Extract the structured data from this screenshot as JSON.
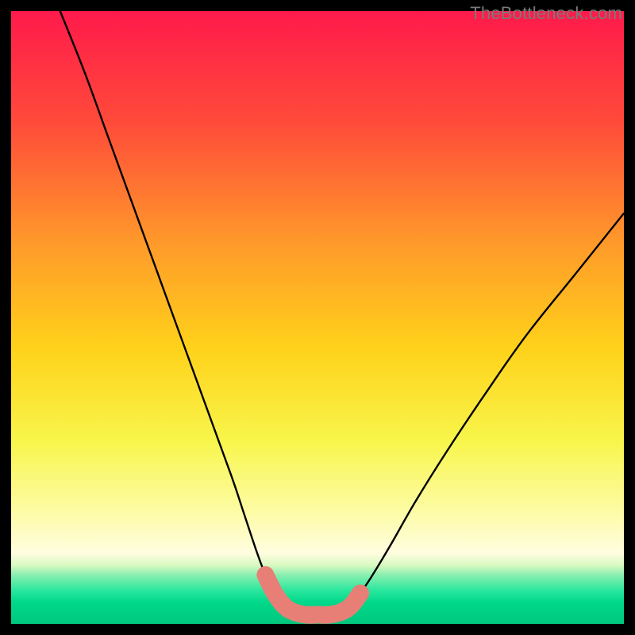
{
  "watermark": "TheBottleneck.com",
  "chart_data": {
    "type": "line",
    "title": "",
    "xlabel": "",
    "ylabel": "",
    "xlim": [
      0,
      100
    ],
    "ylim": [
      0,
      100
    ],
    "series": [
      {
        "name": "left-branch",
        "x": [
          8,
          12,
          16,
          20,
          24,
          28,
          32,
          36,
          38,
          40,
          41.5,
          43,
          44.5,
          46
        ],
        "y": [
          100,
          90,
          79,
          68,
          57,
          46,
          35,
          24,
          18,
          12,
          8,
          5,
          3,
          2
        ]
      },
      {
        "name": "right-branch",
        "x": [
          54,
          55.5,
          57,
          59,
          62,
          66,
          71,
          77,
          84,
          92,
          100
        ],
        "y": [
          2,
          3,
          5,
          8,
          13,
          20,
          28,
          37,
          47,
          57,
          67
        ]
      }
    ],
    "highlight_segment": {
      "name": "optimal-band",
      "x": [
        41.5,
        43,
        44.5,
        46,
        48,
        50,
        52,
        54,
        55.5,
        57
      ],
      "y": [
        8,
        5,
        3,
        2,
        1.5,
        1.5,
        1.5,
        2,
        3,
        5
      ]
    },
    "gradient_stops": [
      {
        "offset": 0.0,
        "color": "#ff1a4b"
      },
      {
        "offset": 0.18,
        "color": "#ff4a3a"
      },
      {
        "offset": 0.38,
        "color": "#ff9a2a"
      },
      {
        "offset": 0.55,
        "color": "#ffd21a"
      },
      {
        "offset": 0.7,
        "color": "#f8f54a"
      },
      {
        "offset": 0.82,
        "color": "#fdfca8"
      },
      {
        "offset": 0.885,
        "color": "#fffde0"
      },
      {
        "offset": 0.905,
        "color": "#d6f9c0"
      },
      {
        "offset": 0.92,
        "color": "#8aefb0"
      },
      {
        "offset": 0.945,
        "color": "#2be79e"
      },
      {
        "offset": 0.965,
        "color": "#00d88a"
      },
      {
        "offset": 1.0,
        "color": "#00c87e"
      }
    ],
    "colors": {
      "curve": "#000000",
      "highlight": "#e77f77"
    }
  }
}
